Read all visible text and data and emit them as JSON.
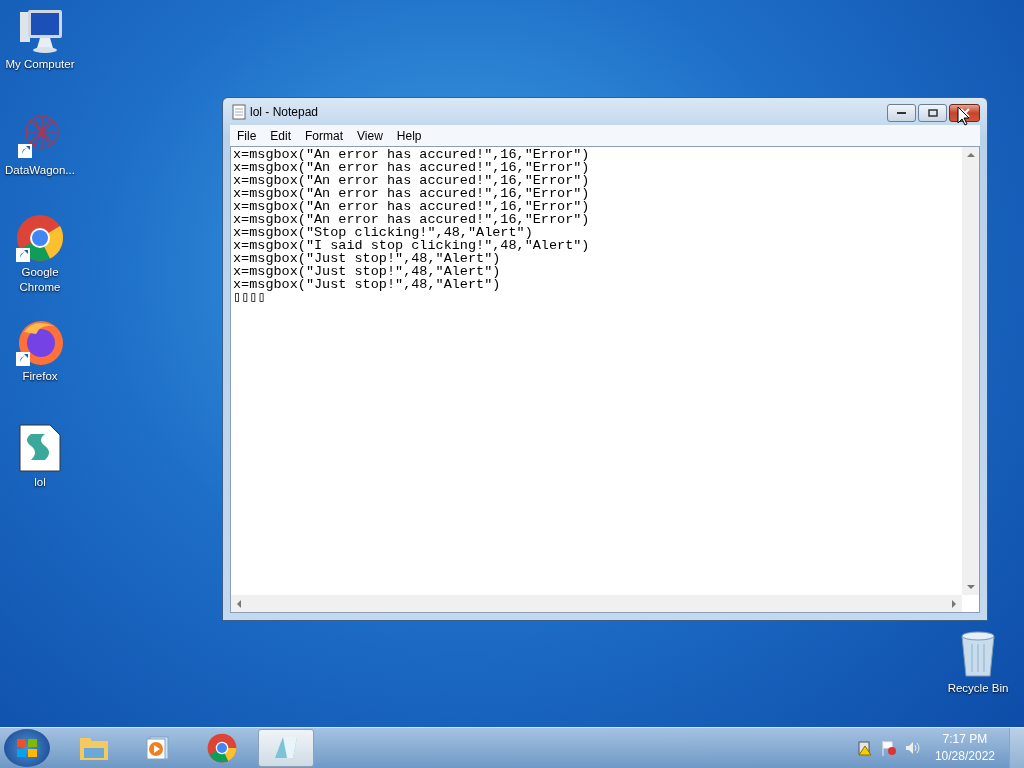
{
  "desktop_icons": [
    {
      "label": "My Computer",
      "kind": "computer"
    },
    {
      "label": "DataWagon...",
      "kind": "network"
    },
    {
      "label": "Google Chrome",
      "kind": "chrome"
    },
    {
      "label": "Firefox",
      "kind": "firefox"
    },
    {
      "label": "lol",
      "kind": "script"
    }
  ],
  "recycle_bin": {
    "label": "Recycle Bin"
  },
  "window": {
    "title": "lol - Notepad",
    "menu": [
      "File",
      "Edit",
      "Format",
      "View",
      "Help"
    ],
    "lines": [
      "x=msgbox(\"An error has accured!\",16,\"Error\")",
      "x=msgbox(\"An error has accured!\",16,\"Error\")",
      "x=msgbox(\"An error has accured!\",16,\"Error\")",
      "x=msgbox(\"An error has accured!\",16,\"Error\")",
      "x=msgbox(\"An error has accured!\",16,\"Error\")",
      "x=msgbox(\"An error has accured!\",16,\"Error\")",
      "x=msgbox(\"Stop clicking!\",48,\"Alert\")",
      "x=msgbox(\"I said stop clicking!\",48,\"Alert\")",
      "x=msgbox(\"Just stop!\",48,\"Alert\")",
      "x=msgbox(\"Just stop!\",48,\"Alert\")",
      "x=msgbox(\"Just stop!\",48,\"Alert\")",
      "▯▯▯▯"
    ]
  },
  "taskbar": {
    "items": [
      {
        "kind": "explorer",
        "selected": false
      },
      {
        "kind": "media",
        "selected": false
      },
      {
        "kind": "chrome",
        "selected": false
      },
      {
        "kind": "notepad",
        "selected": true
      }
    ],
    "time": "7:17 PM",
    "date": "10/28/2022"
  }
}
